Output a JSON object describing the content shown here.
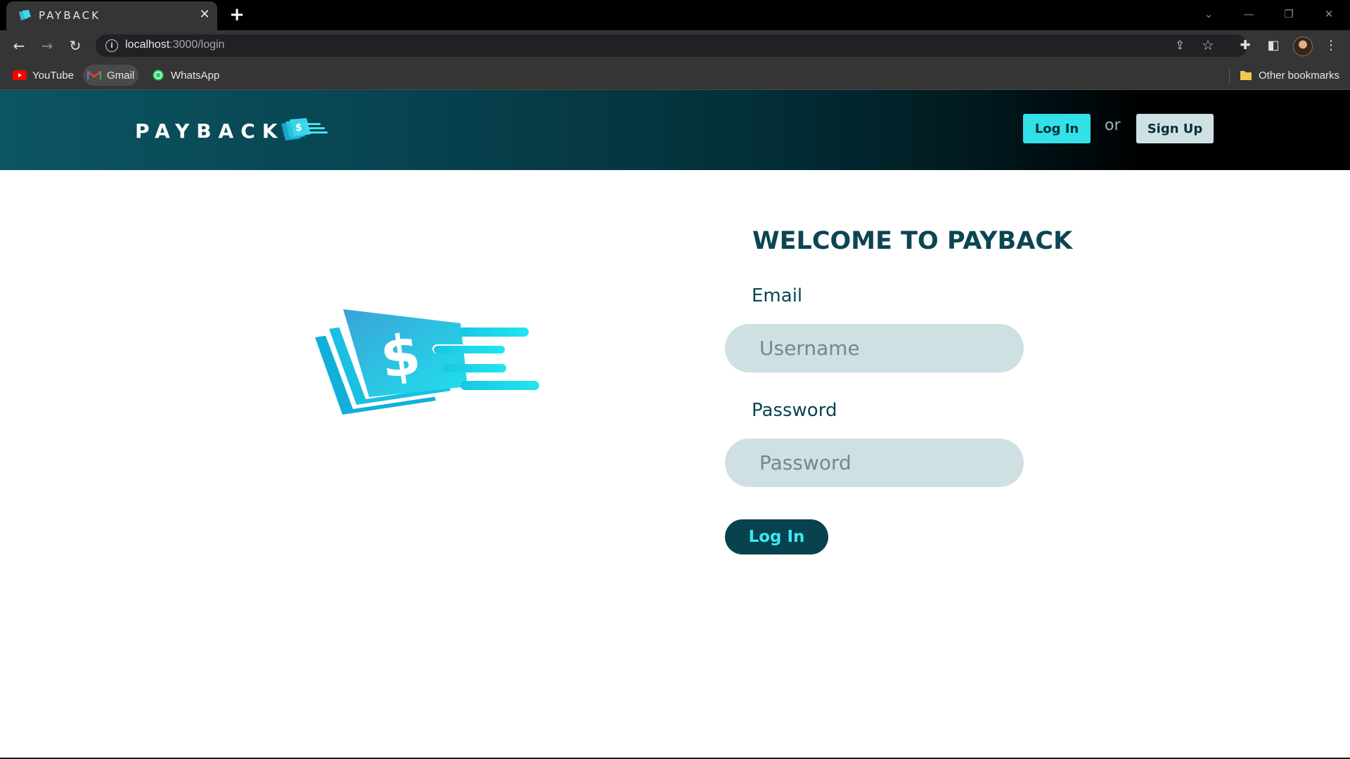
{
  "browser": {
    "tab_title": "PAYBACK",
    "tab_close": "✕",
    "new_tab": "+",
    "url_host": "localhost",
    "url_path": ":3000/login",
    "bookmarks": [
      {
        "label": "YouTube",
        "icon": "youtube-icon"
      },
      {
        "label": "Gmail",
        "icon": "gmail-icon"
      },
      {
        "label": "WhatsApp",
        "icon": "whatsapp-icon"
      }
    ],
    "other_bookmarks": "Other bookmarks"
  },
  "header": {
    "brand": "PAYBACK",
    "login_label": "Log In",
    "or_label": "or",
    "signup_label": "Sign Up"
  },
  "login_form": {
    "title": "WELCOME TO PAYBACK",
    "email_label": "Email",
    "email_placeholder": "Username",
    "password_label": "Password",
    "password_placeholder": "Password",
    "submit_label": "Log In"
  },
  "colors": {
    "brand_dark": "#0b4652",
    "accent_cyan": "#34e0e8",
    "input_bg": "#cfe0e3"
  }
}
